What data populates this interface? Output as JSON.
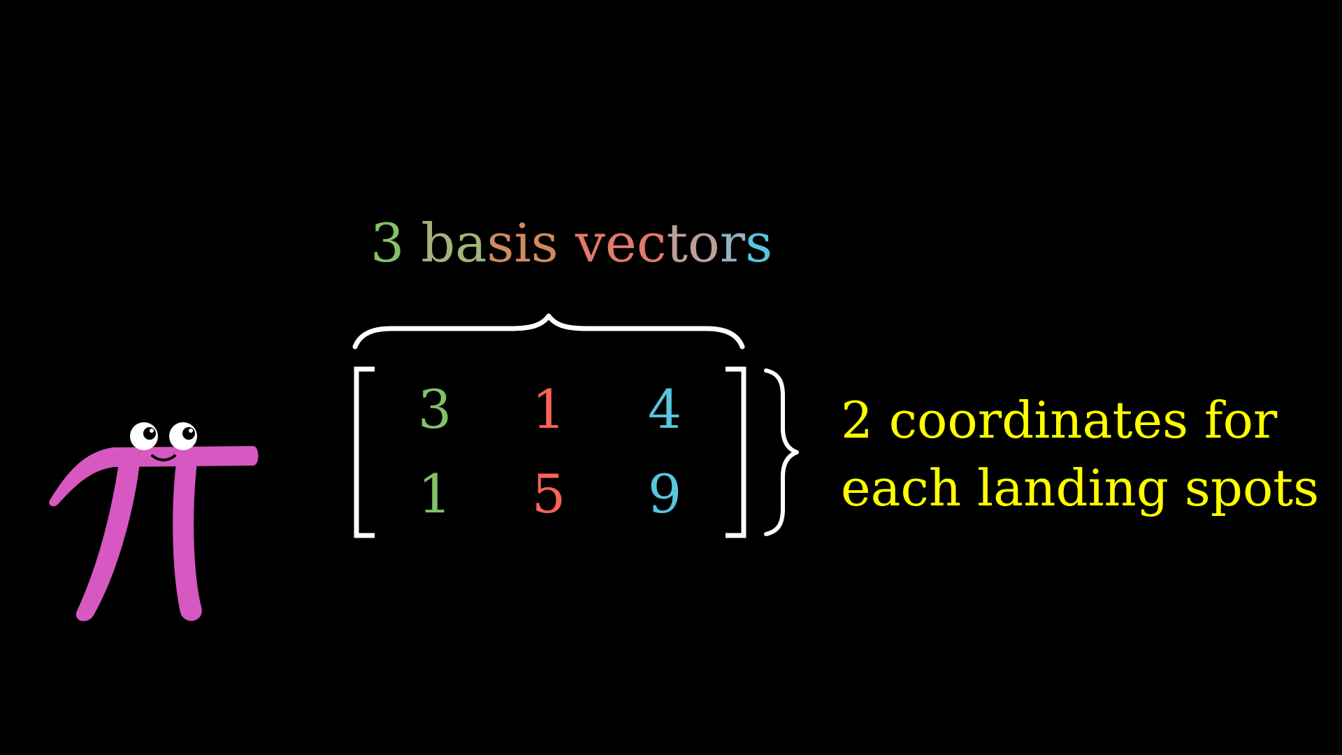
{
  "top_label": {
    "parts": [
      {
        "text": "3 ",
        "color": "#83c167"
      },
      {
        "text": "ba",
        "color": "#a3b47b"
      },
      {
        "text": "sis",
        "color": "#d18a5f"
      },
      {
        "text": " ",
        "color": "#ffffff"
      },
      {
        "text": "vec",
        "color": "#e07a6a"
      },
      {
        "text": "to",
        "color": "#bba198"
      },
      {
        "text": "r",
        "color": "#8fb3c0"
      },
      {
        "text": "s",
        "color": "#58c4dd"
      }
    ]
  },
  "matrix": {
    "rows": [
      [
        {
          "value": "3",
          "color": "#83c167"
        },
        {
          "value": "1",
          "color": "#fc6255"
        },
        {
          "value": "4",
          "color": "#58c4dd"
        }
      ],
      [
        {
          "value": "1",
          "color": "#83c167"
        },
        {
          "value": "5",
          "color": "#fc6255"
        },
        {
          "value": "9",
          "color": "#58c4dd"
        }
      ]
    ]
  },
  "side_label": {
    "line1": "2 coordinates for",
    "line2": "each landing spots",
    "color": "#ffff00"
  },
  "character": {
    "type": "pi-creature",
    "color": "#d658c0",
    "icon": "pi-creature-icon"
  },
  "colors": {
    "background": "#000000",
    "brackets": "#ffffff",
    "braces": "#ffffff"
  }
}
